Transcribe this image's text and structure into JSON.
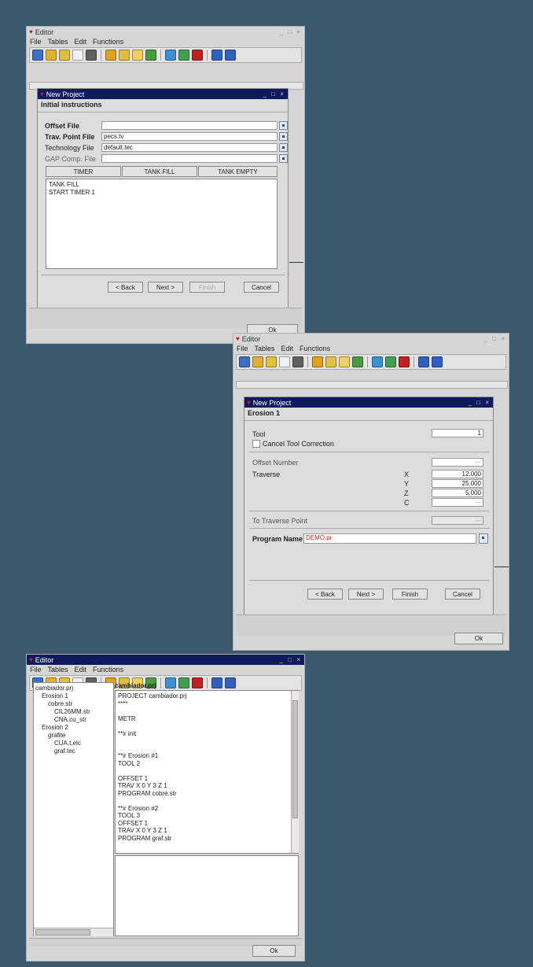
{
  "toolbar_colors": [
    "#3d6fc4",
    "#e0b030",
    "#e0c040",
    "#f0f0f0",
    "#606060",
    "#e0a020",
    "#e0c040",
    "#f0d060",
    "#4a9a40",
    "#3d8fd0",
    "#40a050",
    "#c02020",
    "#3060c0",
    "#3060c0"
  ],
  "w1": {
    "title": "Editor",
    "menu": [
      "File",
      "Tables",
      "Edit",
      "Functions"
    ],
    "dialog_title": "New Project",
    "subtitle": "Initial instructions",
    "fields": [
      {
        "label": "Offset File",
        "value": ""
      },
      {
        "label": "Trav. Point File",
        "value": "pecs.tv"
      },
      {
        "label": "Technology File",
        "value": "default.tec"
      },
      {
        "label": "GAP Comp. File",
        "value": ""
      }
    ],
    "tabs": [
      "TIMER",
      "TANK FILL",
      "TANK EMPTY"
    ],
    "text_lines": [
      "TANK FILL",
      "START TIMER 1"
    ],
    "back": "< Back",
    "next": "Next >",
    "finish": "Finish",
    "cancel": "Cancel",
    "ok": "Ok"
  },
  "w2": {
    "title": "Editor",
    "menu": [
      "File",
      "Tables",
      "Edit",
      "Functions"
    ],
    "dialog_title": "New Project",
    "subtitle": "Erosion 1",
    "tool_label": "Tool",
    "tool_value": "1",
    "cancel_tool": "Cancel Tool Correction",
    "offset_label": "Offset Number",
    "offset_value": "---",
    "traverse_label": "Traverse",
    "axes": [
      {
        "a": "X",
        "v": "12.000"
      },
      {
        "a": "Y",
        "v": "25.000"
      },
      {
        "a": "Z",
        "v": "5.000"
      },
      {
        "a": "C",
        "v": "---"
      }
    ],
    "tp_label": "To Traverse Point",
    "tp_value": "---",
    "prog_label": "Program Name",
    "prog_value": "DEMO.pr",
    "back": "< Back",
    "next": "Next >",
    "finish": "Finish",
    "cancel": "Cancel",
    "ok": "Ok"
  },
  "w3": {
    "title": "Editor",
    "menu": [
      "File",
      "Tables",
      "Edit",
      "Functions"
    ],
    "tree": [
      {
        "t": "cambiador.prj",
        "d": 0
      },
      {
        "t": "Erosion 1",
        "d": 1
      },
      {
        "t": "cobre.str",
        "d": 2
      },
      {
        "t": "CIL26MM.str",
        "d": 3
      },
      {
        "t": "CNA.cu_str",
        "d": 3
      },
      {
        "t": "Erosion 2",
        "d": 1
      },
      {
        "t": "grafite",
        "d": 2
      },
      {
        "t": "CUA.t.elc",
        "d": 3
      },
      {
        "t": "graf.tec",
        "d": 3
      }
    ],
    "file_header": "cambiador.prj",
    "code": [
      "PROJECT cambiador.prj",
      "****",
      "",
      "METR",
      "",
      "**ir init",
      "",
      "",
      "**ir Erosion #1",
      "TOOL 2",
      "",
      "OFFSET 1",
      "TRAV  X 0 Y 3 Z 1",
      "PROGRAM cobre.str",
      "",
      "**ir Erosion #2",
      "TOOL 3",
      "OFFSET 1",
      "TRAV  X 0 Y 3 Z 1",
      "PROGRAM graf.str"
    ],
    "ok": "Ok"
  }
}
